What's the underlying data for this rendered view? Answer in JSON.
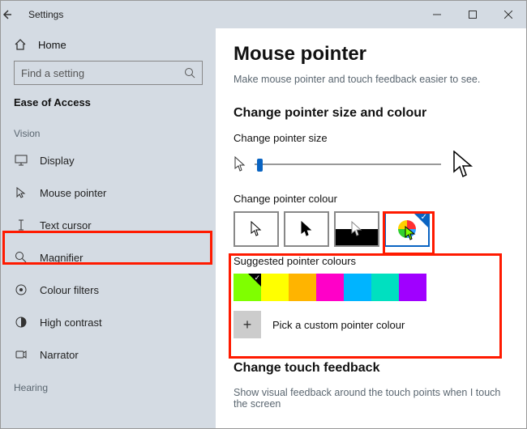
{
  "titlebar": {
    "title": "Settings"
  },
  "sidebar": {
    "home": "Home",
    "search_placeholder": "Find a setting",
    "section": "Ease of Access",
    "group_vision": "Vision",
    "group_hearing": "Hearing",
    "items": [
      {
        "label": "Display"
      },
      {
        "label": "Mouse pointer"
      },
      {
        "label": "Text cursor"
      },
      {
        "label": "Magnifier"
      },
      {
        "label": "Colour filters"
      },
      {
        "label": "High contrast"
      },
      {
        "label": "Narrator"
      }
    ]
  },
  "content": {
    "title": "Mouse pointer",
    "subtitle": "Make mouse pointer and touch feedback easier to see.",
    "h_size_colour": "Change pointer size and colour",
    "lbl_size": "Change pointer size",
    "lbl_colour": "Change pointer colour",
    "lbl_suggested": "Suggested pointer colours",
    "custom_label": "Pick a custom pointer colour",
    "h_touch": "Change touch feedback",
    "touch_sub": "Show visual feedback around the touch points when I touch the screen"
  },
  "swatches": [
    "#7fff00",
    "#ffff00",
    "#ffb400",
    "#ff00c8",
    "#00b4ff",
    "#00e0c0",
    "#a000ff"
  ],
  "selected_swatch_index": 0,
  "selected_colour_option_index": 3
}
